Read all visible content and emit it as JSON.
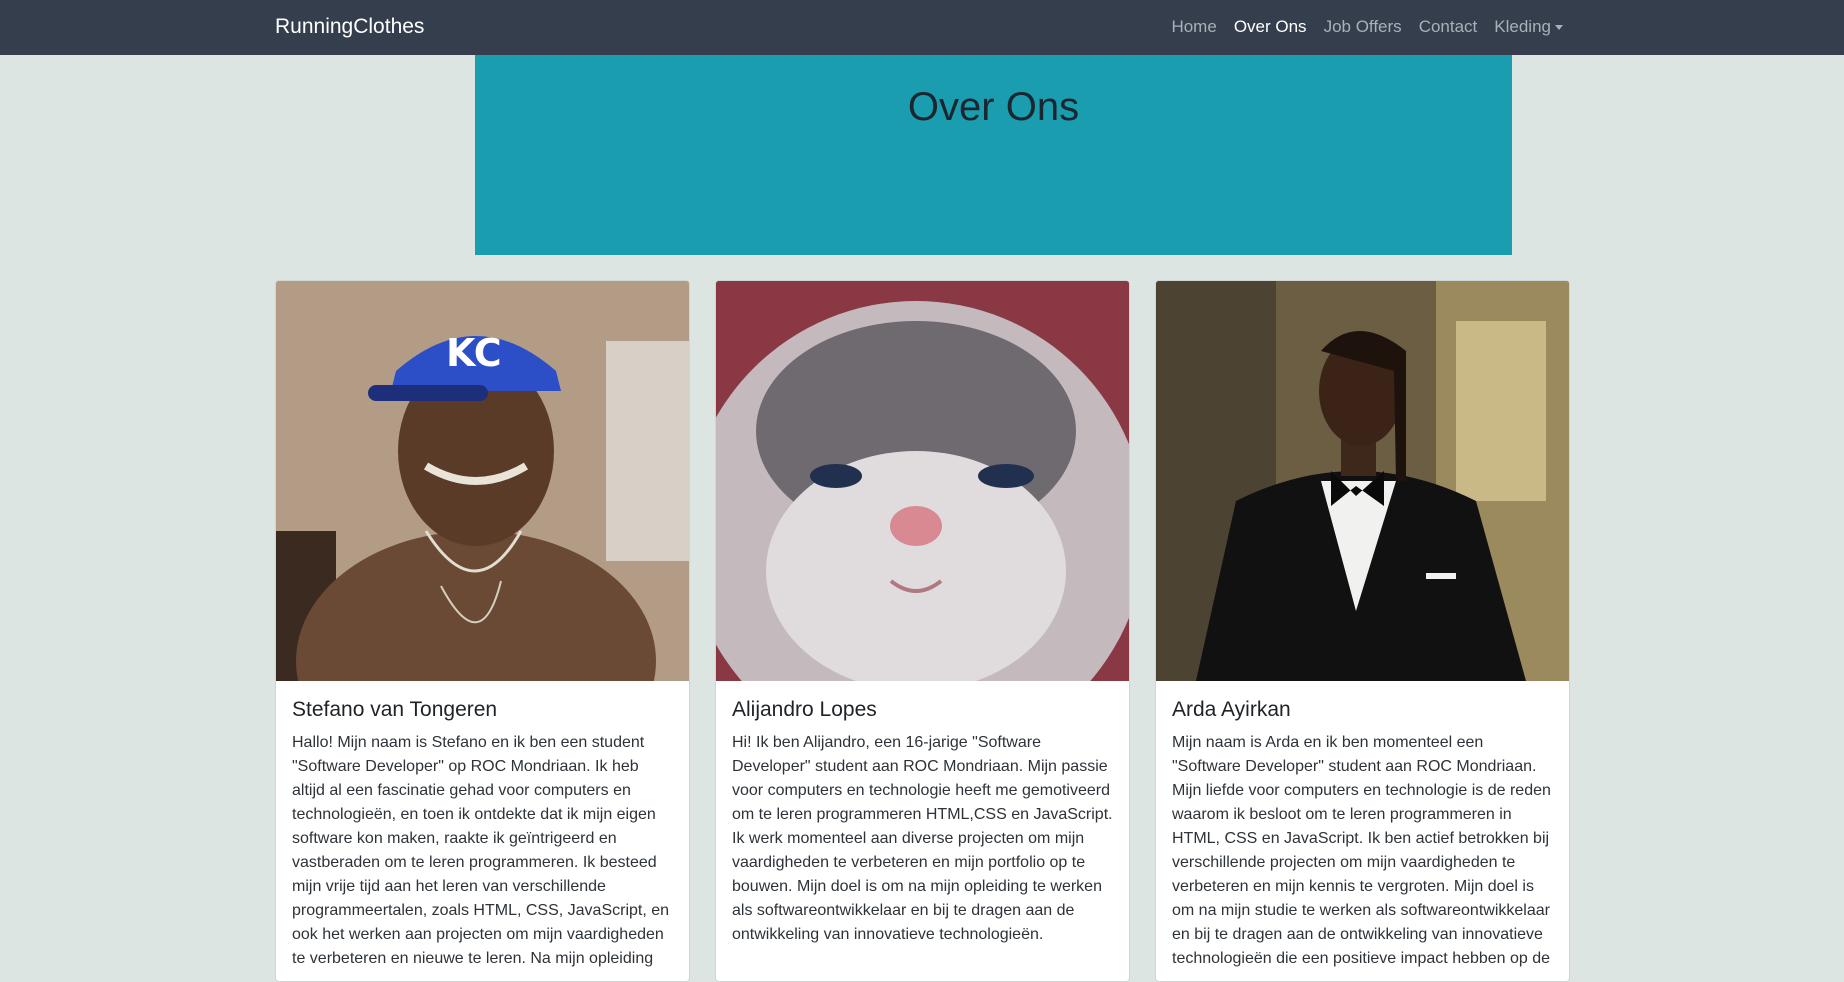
{
  "navbar": {
    "brand": "RunningClothes",
    "links": [
      "Home",
      "Over Ons",
      "Job Offers",
      "Contact",
      "Kleding"
    ]
  },
  "hero": {
    "title": "Over Ons"
  },
  "cards": [
    {
      "name": "Stefano van Tongeren",
      "text": "Hallo! Mijn naam is Stefano en ik ben een student \"Software Developer\" op ROC Mondriaan. Ik heb altijd al een fascinatie gehad voor computers en technologieën, en toen ik ontdekte dat ik mijn eigen software kon maken, raakte ik geïntrigeerd en vastberaden om te leren programmeren. Ik besteed mijn vrije tijd aan het leren van verschillende programmeertalen, zoals HTML, CSS, JavaScript, en ook het werken aan projecten om mijn vaardigheden te verbeteren en nieuwe te leren. Na mijn opleiding"
    },
    {
      "name": "Alijandro Lopes",
      "text": "Hi! Ik ben Alijandro, een 16-jarige \"Software Developer\" student aan ROC Mondriaan. Mijn passie voor computers en technologie heeft me gemotiveerd om te leren programmeren HTML,CSS en JavaScript. Ik werk momenteel aan diverse projecten om mijn vaardigheden te verbeteren en mijn portfolio op te bouwen. Mijn doel is om na mijn opleiding te werken als softwareontwikkelaar en bij te dragen aan de ontwikkeling van innovatieve technologieën."
    },
    {
      "name": "Arda Ayirkan",
      "text": "Mijn naam is Arda en ik ben momenteel een \"Software Developer\" student aan ROC Mondriaan. Mijn liefde voor computers en technologie is de reden waarom ik besloot om te leren programmeren in HTML, CSS en JavaScript. Ik ben actief betrokken bij verschillende projecten om mijn vaardigheden te verbeteren en mijn kennis te vergroten. Mijn doel is om na mijn studie te werken als softwareontwikkelaar en bij te dragen aan de ontwikkeling van innovatieve technologieën die een positieve impact hebben op de"
    }
  ],
  "colors": {
    "navbar": "#343e4c",
    "page_bg": "#dde5e3",
    "hero_bg": "#1a9daf"
  }
}
